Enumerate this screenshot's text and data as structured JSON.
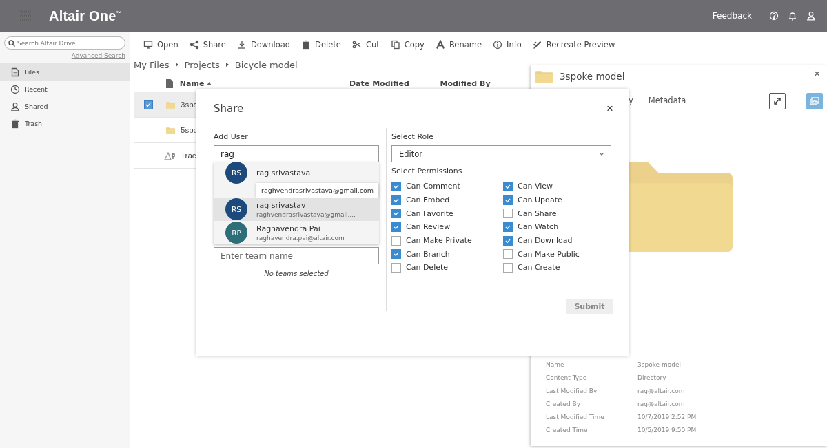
{
  "header": {
    "title": "Altair One$^{™}$",
    "feedback": "Feedback"
  },
  "sidebar": {
    "search_placeholder": "Search Altair Drive",
    "advanced_search": "Advanced Search",
    "items": [
      {
        "label": "Files",
        "kind": "files",
        "selected": true
      },
      {
        "label": "Recent",
        "kind": "recent",
        "selected": false
      },
      {
        "label": "Shared",
        "kind": "shared",
        "selected": false
      },
      {
        "label": "Trash",
        "kind": "trash",
        "selected": false
      }
    ]
  },
  "toolbar": [
    {
      "label": "Open",
      "kind": "open"
    },
    {
      "label": "Share",
      "kind": "share"
    },
    {
      "label": "Download",
      "kind": "download"
    },
    {
      "label": "Delete",
      "kind": "delete"
    },
    {
      "label": "Cut",
      "kind": "cut"
    },
    {
      "label": "Copy",
      "kind": "copy"
    },
    {
      "label": "Rename",
      "kind": "rename"
    },
    {
      "label": "Info",
      "kind": "info"
    },
    {
      "label": "Recreate Preview",
      "kind": "recreate"
    }
  ],
  "breadcrumb": [
    "My Files",
    "Projects",
    "Bicycle model"
  ],
  "table": {
    "columns": [
      "Name",
      "Date Modified",
      "Modified By"
    ],
    "rows": [
      {
        "name": "3spo",
        "kind": "folder",
        "selected": true
      },
      {
        "name": "5spo",
        "kind": "folder",
        "selected": false
      },
      {
        "name": "Trac",
        "kind": "model",
        "selected": false
      }
    ]
  },
  "details": {
    "title": "3spoke model",
    "close": "×",
    "tabs": [
      {
        "label": "y",
        "selected": false
      },
      {
        "label": "Metadata",
        "selected": false
      }
    ],
    "properties": [
      {
        "name": "Name",
        "value": "3spoke model"
      },
      {
        "name": "Content Type",
        "value": "Directory"
      },
      {
        "name": "Last Modified By",
        "value": "rag@altair.com"
      },
      {
        "name": "Created By",
        "value": "rag@altair.com"
      },
      {
        "name": "Last Modified Time",
        "value": "10/7/2019 2:52 PM"
      },
      {
        "name": "Created Time",
        "value": "10/5/2019 9:50 PM"
      }
    ]
  },
  "dialog": {
    "title": "Share",
    "close": "×",
    "add_user_label": "Add User",
    "user_query": "rag",
    "suggestions": [
      {
        "initials": "RS",
        "name": "rag srivastava",
        "color": "#1d4a7c",
        "selected": false
      },
      {
        "initials": "RS",
        "name": "rag srivastav",
        "email": "raghvendrasrivastava@gmail....",
        "color": "#1d4a7c",
        "selected": true
      },
      {
        "initials": "RP",
        "name": "Raghavendra Pai",
        "email": "raghavendra.pai@altair.com",
        "color": "#2e6e78",
        "selected": false
      }
    ],
    "tooltip": "raghvendrasrivastava@gmail.com",
    "team_placeholder": "Enter team name",
    "no_teams": "No teams selected",
    "role_label": "Select Role",
    "role": "Editor",
    "permissions_label": "Select Permissions",
    "permissions": [
      {
        "label": "Can Comment",
        "checked": true
      },
      {
        "label": "Can Embed",
        "checked": true
      },
      {
        "label": "Can Favorite",
        "checked": true
      },
      {
        "label": "Can Review",
        "checked": true
      },
      {
        "label": "Can Make Private",
        "checked": false
      },
      {
        "label": "Can Branch",
        "checked": true
      },
      {
        "label": "Can Delete",
        "checked": false
      },
      {
        "label": "Can View",
        "checked": true
      },
      {
        "label": "Can Update",
        "checked": true
      },
      {
        "label": "Can Share",
        "checked": false
      },
      {
        "label": "Can Watch",
        "checked": true
      },
      {
        "label": "Can Download",
        "checked": true
      },
      {
        "label": "Can Make Public",
        "checked": false
      },
      {
        "label": "Can Create",
        "checked": false
      }
    ],
    "submit": {
      "label": "Submit",
      "disabled": true
    }
  }
}
